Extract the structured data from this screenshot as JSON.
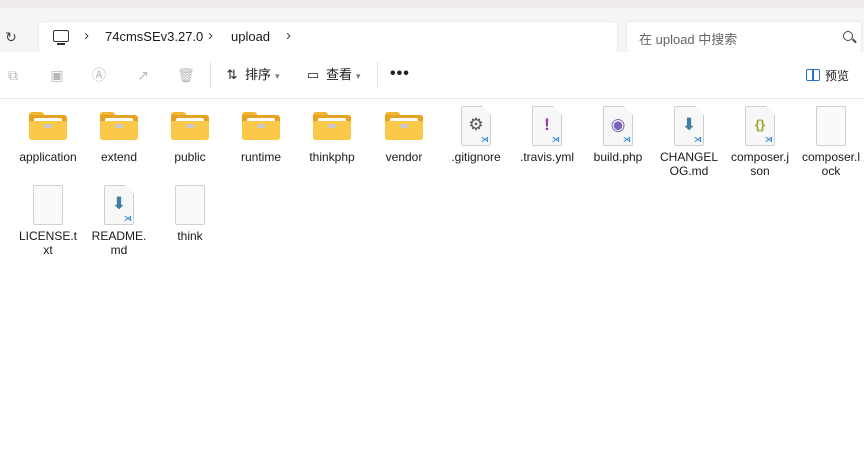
{
  "address_bar": {
    "crumbs": [
      "74cmsSEv3.27.0",
      "upload"
    ],
    "search_placeholder": "在 upload 中搜索"
  },
  "toolbar": {
    "sort_label": "排序",
    "view_label": "查看",
    "more_label": "•••",
    "preview_label": "预览"
  },
  "files": [
    {
      "name": "application",
      "type": "folder"
    },
    {
      "name": "extend",
      "type": "folder"
    },
    {
      "name": "public",
      "type": "folder"
    },
    {
      "name": "runtime",
      "type": "folder"
    },
    {
      "name": "thinkphp",
      "type": "folder"
    },
    {
      "name": "vendor",
      "type": "folder"
    },
    {
      "name": ".gitignore",
      "type": "file",
      "icon": "gear-icon",
      "glyph": "⚙",
      "color": "#555555"
    },
    {
      "name": ".travis.yml",
      "type": "file",
      "icon": "exclamation-icon",
      "glyph": "!",
      "color": "#9b37b0"
    },
    {
      "name": "build.php",
      "type": "file",
      "icon": "php-elephant-icon",
      "glyph": "◉",
      "color": "#7b62b8"
    },
    {
      "name": "CHANGELOG.md",
      "type": "file",
      "icon": "markdown-download-icon",
      "glyph": "⬇",
      "color": "#3d7fa3"
    },
    {
      "name": "composer.json",
      "type": "file",
      "icon": "json-braces-icon",
      "glyph": "{}",
      "color": "#9aa52a"
    },
    {
      "name": "composer.lock",
      "type": "blank"
    },
    {
      "name": "LICENSE.txt",
      "type": "blank"
    },
    {
      "name": "README.md",
      "type": "file",
      "icon": "markdown-download-icon",
      "glyph": "⬇",
      "color": "#3d7fa3"
    },
    {
      "name": "think",
      "type": "blank"
    }
  ]
}
